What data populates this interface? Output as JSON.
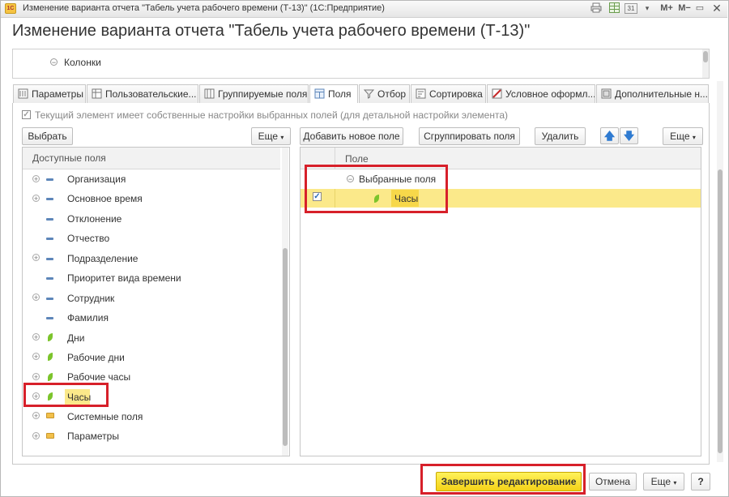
{
  "window": {
    "title": "Изменение варианта отчета \"Табель учета рабочего времени (Т-13)\"  (1С:Предприятие)",
    "app_icon": "1С",
    "toolbar": {
      "print": "print-icon",
      "table": "table-icon",
      "calendar": "31",
      "mplus": "M+",
      "mminus": "M−",
      "minimize": "▭",
      "close": "✕"
    }
  },
  "page_title": "Изменение варианта отчета \"Табель учета рабочего времени (Т-13)\"",
  "structure": {
    "columns_label": "Колонки"
  },
  "tabs": [
    {
      "label": "Параметры",
      "icon": "parameters-icon"
    },
    {
      "label": "Пользовательские...",
      "icon": "user-fields-icon"
    },
    {
      "label": "Группируемые поля",
      "icon": "grouping-icon"
    },
    {
      "label": "Поля",
      "icon": "fields-icon"
    },
    {
      "label": "Отбор",
      "icon": "filter-icon"
    },
    {
      "label": "Сортировка",
      "icon": "sort-icon"
    },
    {
      "label": "Условное оформл...",
      "icon": "conditional-format-icon"
    },
    {
      "label": "Дополнительные н...",
      "icon": "additional-settings-icon"
    }
  ],
  "own_settings": {
    "checked": true,
    "label": "Текущий элемент имеет собственные настройки выбранных полей (для детальной настройки элемента)"
  },
  "left": {
    "select_button": "Выбрать",
    "more_button": "Еще",
    "header": "Доступные поля",
    "items": [
      {
        "label": "Организация",
        "expandable": true,
        "icon": "dimension-icon"
      },
      {
        "label": "Основное время",
        "expandable": true,
        "icon": "dimension-icon"
      },
      {
        "label": "Отклонение",
        "expandable": false,
        "icon": "dimension-icon"
      },
      {
        "label": "Отчество",
        "expandable": false,
        "icon": "dimension-icon"
      },
      {
        "label": "Подразделение",
        "expandable": true,
        "icon": "dimension-icon"
      },
      {
        "label": "Приоритет вида времени",
        "expandable": false,
        "icon": "dimension-icon"
      },
      {
        "label": "Сотрудник",
        "expandable": true,
        "icon": "dimension-icon"
      },
      {
        "label": "Фамилия",
        "expandable": false,
        "icon": "dimension-icon"
      },
      {
        "label": "Дни",
        "expandable": true,
        "icon": "resource-icon"
      },
      {
        "label": "Рабочие дни",
        "expandable": true,
        "icon": "resource-icon"
      },
      {
        "label": "Рабочие часы",
        "expandable": true,
        "icon": "resource-icon"
      },
      {
        "label": "Часы",
        "expandable": true,
        "icon": "resource-icon"
      },
      {
        "label": "Системные поля",
        "expandable": true,
        "icon": "folder-icon"
      },
      {
        "label": "Параметры",
        "expandable": true,
        "icon": "folder-icon"
      }
    ]
  },
  "right": {
    "add_button": "Добавить новое поле",
    "group_button": "Сгруппировать поля",
    "delete_button": "Удалить",
    "up_arrow": "🡅",
    "down_arrow": "🡇",
    "more_button": "Еще",
    "header": "Поле",
    "group_label": "Выбранные поля",
    "selected_item": "Часы",
    "selected_checked": true
  },
  "footer": {
    "finish_button": "Завершить редактирование",
    "cancel_button": "Отмена",
    "more_button": "Еще",
    "help_button": "?"
  },
  "colors": {
    "highlight": "#fbe98a",
    "annotation_red": "#d7202a",
    "primary_button": "#f4d217"
  }
}
